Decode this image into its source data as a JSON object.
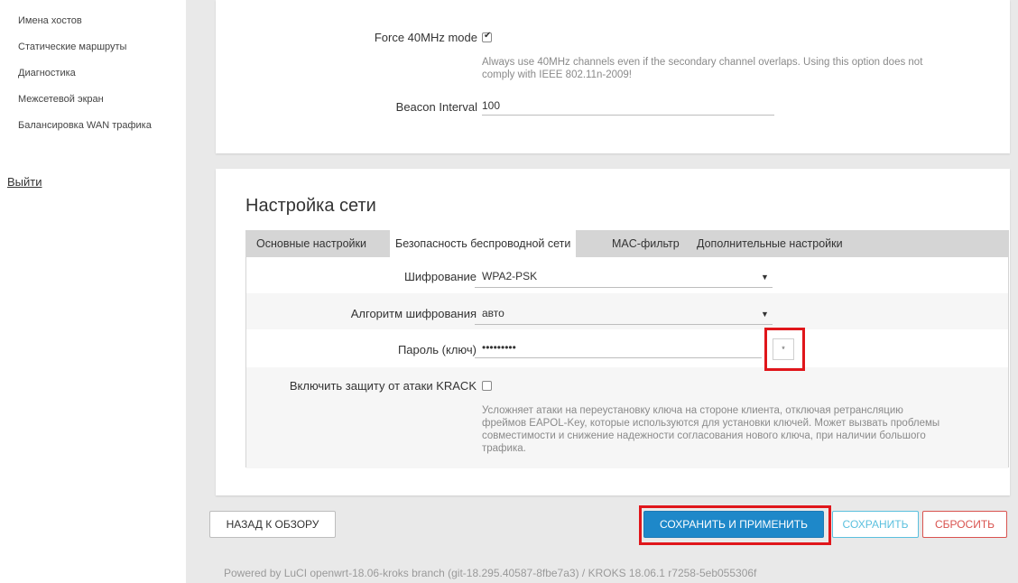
{
  "sidebar": {
    "items": [
      {
        "label": "Имена хостов"
      },
      {
        "label": "Статические маршруты"
      },
      {
        "label": "Диагностика"
      },
      {
        "label": "Межсетевой экран"
      },
      {
        "label": "Балансировка WAN трафика"
      }
    ],
    "logout": "Выйти"
  },
  "device": {
    "force40": {
      "label": "Force 40MHz mode",
      "checked": true,
      "help": "Always use 40MHz channels even if the secondary channel overlaps. Using this option does not comply with IEEE 802.11n-2009!"
    },
    "beacon": {
      "label": "Beacon Interval",
      "value": "100"
    }
  },
  "network": {
    "title": "Настройка сети",
    "tabs": [
      {
        "label": "Основные настройки",
        "active": false
      },
      {
        "label": "Безопасность беспроводной сети",
        "active": true
      },
      {
        "label": "MAC-фильтр",
        "active": false
      },
      {
        "label": "Дополнительные настройки",
        "active": false
      }
    ],
    "encryption": {
      "label": "Шифрование",
      "value": "WPA2-PSK"
    },
    "cipher": {
      "label": "Алгоритм шифрования",
      "value": "авто"
    },
    "key": {
      "label": "Пароль (ключ)",
      "value": "•••••••••",
      "reveal_glyph": "*"
    },
    "krack": {
      "label": "Включить защиту от атаки KRACK",
      "checked": false,
      "help": "Усложняет атаки на переустановку ключа на стороне клиента, отключая ретрансляцию фреймов EAPOL-Key, которые используются для установки ключей. Может вызвать проблемы совместимости и снижение надежности согласования нового ключа, при наличии большого трафика."
    }
  },
  "actions": {
    "back": "НАЗАД К ОБЗОРУ",
    "save_apply": "СОХРАНИТЬ И ПРИМЕНИТЬ",
    "save": "СОХРАНИТЬ",
    "reset": "СБРОСИТЬ"
  },
  "footer": "Powered by LuCI openwrt-18.06-kroks branch (git-18.295.40587-8fbe7a3) / KROKS 18.06.1 r7258-5eb055306f",
  "colors": {
    "primary": "#1e88c9",
    "highlight": "#e0161b",
    "save": "#5bc0de",
    "reset": "#d9534f"
  }
}
